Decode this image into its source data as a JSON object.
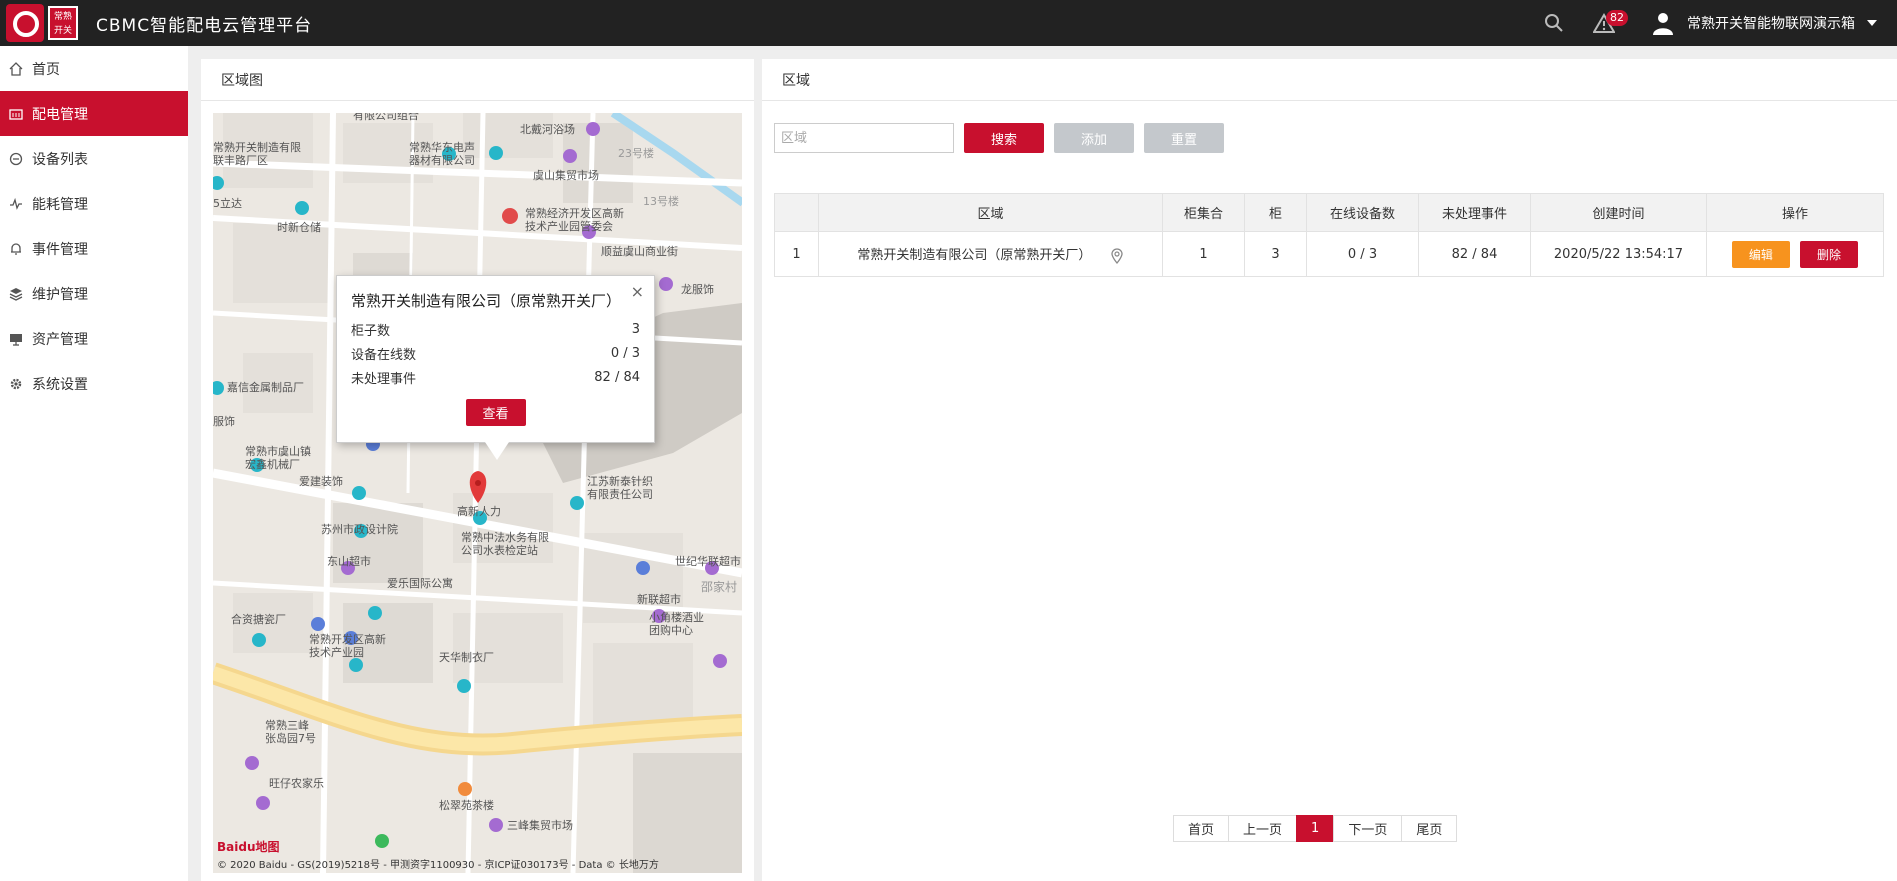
{
  "header": {
    "logo_seal": "常熟\n开关",
    "title": "CBMC智能配电云管理平台",
    "alert_count": "82",
    "user_name": "常熟开关智能物联网演示箱"
  },
  "sidebar": {
    "items": [
      {
        "label": "首页",
        "icon": "home-icon"
      },
      {
        "label": "配电管理",
        "icon": "power-distribution-icon"
      },
      {
        "label": "设备列表",
        "icon": "device-list-icon"
      },
      {
        "label": "能耗管理",
        "icon": "energy-pulse-icon"
      },
      {
        "label": "事件管理",
        "icon": "bell-icon"
      },
      {
        "label": "维护管理",
        "icon": "layers-icon"
      },
      {
        "label": "资产管理",
        "icon": "asset-monitor-icon"
      },
      {
        "label": "系统设置",
        "icon": "gear-icon"
      }
    ],
    "active_index": 1
  },
  "map_panel": {
    "title": "区域图",
    "pois": [
      "有限公司组合",
      "北戴河浴场",
      "常熟开关制造有限\n联丰路厂区",
      "常熟华东电声\n器材有限公司",
      "23号楼",
      "虞山集贸市场",
      "13号楼",
      "5立达",
      "时新仓储",
      "常熟经济开发区高新\n技术产业园管委会",
      "顺益虞山商业街",
      "龙服饰",
      "嘉信金属制品厂",
      "服饰",
      "常熟市虞山镇\n宏鑫机械厂",
      "爱建装饰",
      "江苏新泰针织\n有限责任公司",
      "高新人力",
      "苏州市政设计院",
      "常熟中法水务有限\n公司水表检定站",
      "东山超市",
      "世纪华联超市",
      "爱乐国际公寓",
      "邵家村",
      "新联超市",
      "合资搪瓷厂",
      "小角楼酒业\n团购中心",
      "常熟开发区高新\n技术产业园",
      "天华制衣厂",
      "常熟三峰\n张岛园7号",
      "旺仔农家乐",
      "松翠苑茶楼",
      "三峰集贸市场"
    ],
    "baidu_logo": "Baidu地图",
    "copyright": "© 2020 Baidu - GS(2019)5218号 - 甲测资字1100930 - 京ICP证030173号 - Data © 长地万方",
    "popup": {
      "title": "常熟开关制造有限公司（原常熟开关厂）",
      "rows": [
        {
          "label": "柜子数",
          "value": "3"
        },
        {
          "label": "设备在线数",
          "value": "0 / 3"
        },
        {
          "label": "未处理事件",
          "value": "82 / 84"
        }
      ],
      "button": "查看",
      "close": "×"
    }
  },
  "area_panel": {
    "title": "区域",
    "search": {
      "placeholder": "区域",
      "value": ""
    },
    "buttons": {
      "search": "搜索",
      "add": "添加",
      "reset": "重置"
    },
    "table": {
      "headers": [
        "",
        "区域",
        "柜集合",
        "柜",
        "在线设备数",
        "未处理事件",
        "创建时间",
        "操作"
      ],
      "rows": [
        {
          "index": "1",
          "area": "常熟开关制造有限公司（原常熟开关厂）",
          "cabinet_sets": "1",
          "cabinets": "3",
          "online": "0 / 3",
          "events": "82 / 84",
          "created": "2020/5/22 13:54:17",
          "edit": "编辑",
          "delete": "删除"
        }
      ]
    },
    "pager": {
      "first": "首页",
      "prev": "上一页",
      "current": "1",
      "next": "下一页",
      "last": "尾页"
    }
  },
  "colors": {
    "brand_red": "#c8102e",
    "edit_orange": "#f7931e",
    "disabled_gray": "#c4c8cc",
    "topbar": "#222222"
  }
}
